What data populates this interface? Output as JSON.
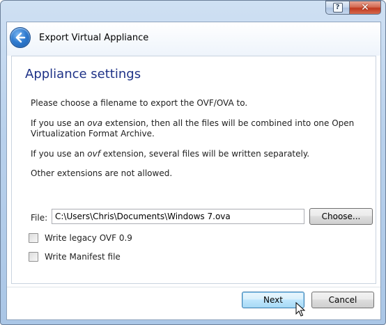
{
  "window": {
    "title": "Export Virtual Appliance",
    "help_label": "?",
    "close_label": "✕"
  },
  "page": {
    "heading": "Appliance settings",
    "intro": "Please choose a filename to export the OVF/OVA to.",
    "ova_prefix": "If you use an ",
    "ova_ext": "ova",
    "ova_suffix": " extension, then all the files will be combined into one Open Virtualization Format Archive.",
    "ovf_prefix": "If you use an ",
    "ovf_ext": "ovf",
    "ovf_suffix": " extension, several files will be written separately.",
    "other": "Other extensions are not allowed."
  },
  "file": {
    "label": "File:",
    "value": "C:\\Users\\Chris\\Documents\\Windows 7.ova",
    "choose_label": "Choose..."
  },
  "options": [
    {
      "label": "Write legacy OVF 0.9",
      "checked": false
    },
    {
      "label": "Write Manifest file",
      "checked": false
    }
  ],
  "footer": {
    "next_label": "Next",
    "cancel_label": "Cancel"
  },
  "icons": {
    "back": "back-arrow-icon",
    "help": "help-icon",
    "close": "close-icon",
    "cursor": "mouse-pointer-icon"
  },
  "colors": {
    "heading": "#1e3287",
    "accent": "#2f7bd0",
    "close_button": "#c0391f"
  }
}
